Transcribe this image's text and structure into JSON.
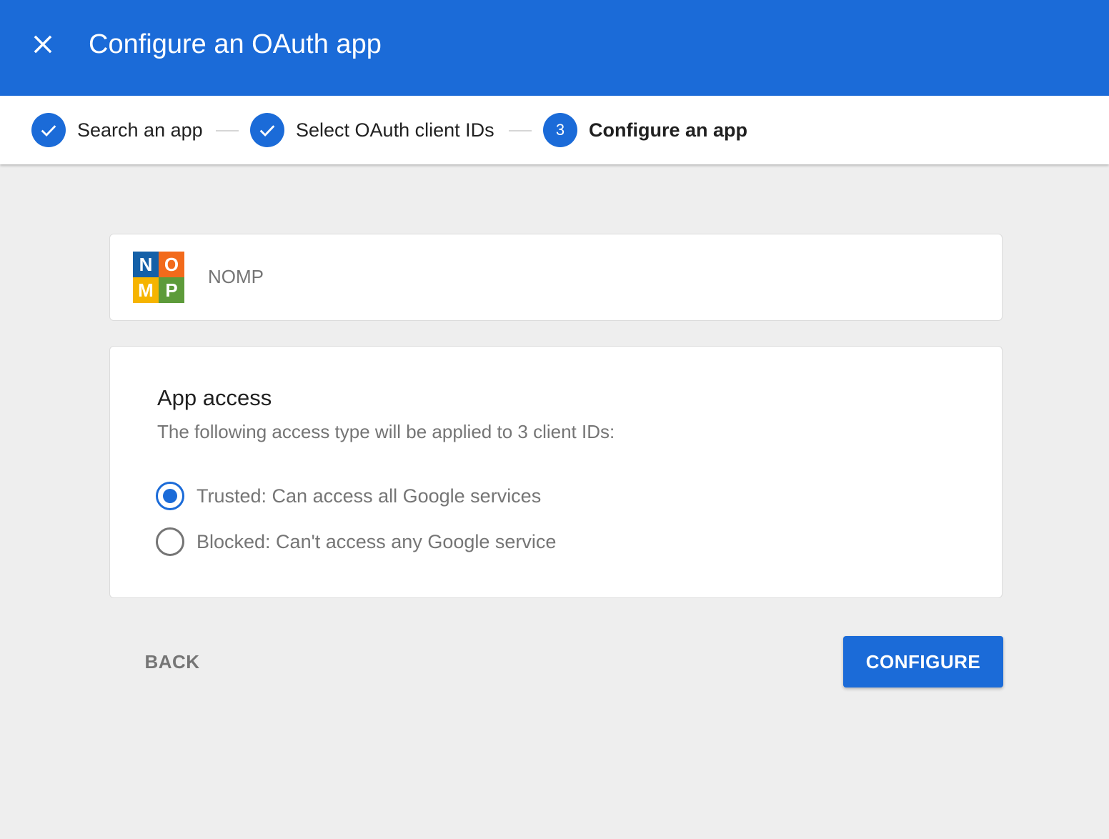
{
  "header": {
    "title": "Configure an OAuth app",
    "close_icon": "close-icon"
  },
  "stepper": {
    "steps": [
      {
        "label": "Search an app",
        "status": "completed",
        "icon": "check-icon"
      },
      {
        "label": "Select OAuth client IDs",
        "status": "completed",
        "icon": "check-icon"
      },
      {
        "label": "Configure an app",
        "status": "active",
        "number": "3"
      }
    ]
  },
  "app": {
    "name": "NOMP",
    "logo": {
      "letters": [
        "N",
        "O",
        "M",
        "P"
      ],
      "colors": [
        "#1460a8",
        "#f26a1b",
        "#f6b400",
        "#5d9b3a"
      ]
    }
  },
  "access": {
    "title": "App access",
    "description": "The following access type will be applied to 3 client IDs:",
    "options": [
      {
        "label": "Trusted: Can access all Google services",
        "selected": true
      },
      {
        "label": "Blocked: Can't access any Google service",
        "selected": false
      }
    ]
  },
  "actions": {
    "back_label": "BACK",
    "configure_label": "CONFIGURE"
  },
  "colors": {
    "primary": "#1b6bd8",
    "background": "#eeeeee",
    "muted_text": "#757575"
  }
}
